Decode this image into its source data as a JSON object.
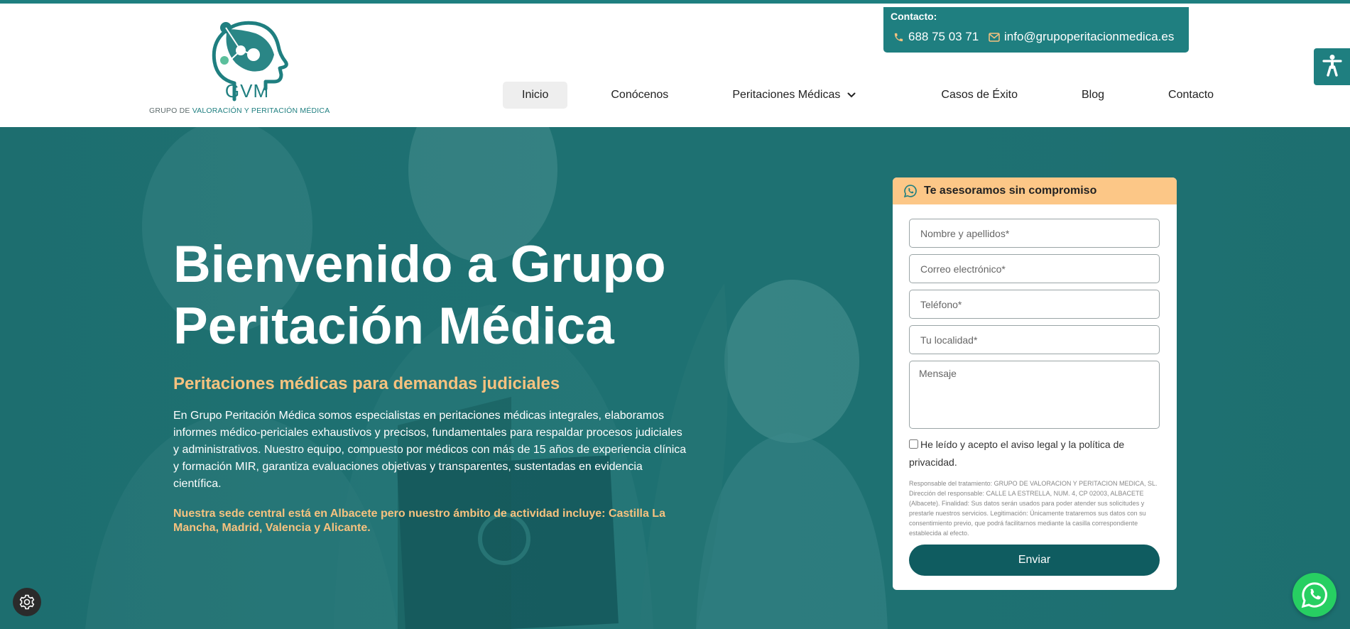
{
  "brand": {
    "caption_prefix": "GRUPO DE ",
    "caption_main": "VALORACIÓN Y PERITACIÓN MÉDICA",
    "logo_text": "GVM",
    "accent": "#1f7f80",
    "highlight": "#f6c27f"
  },
  "contact": {
    "title": "Contacto:",
    "phone": "688 75 03 71",
    "email": "info@grupoperitacionmedica.es",
    "phone_icon": "phone-icon",
    "email_icon": "envelope-icon"
  },
  "nav": {
    "items": [
      {
        "label": "Inicio"
      },
      {
        "label": "Conócenos"
      },
      {
        "label": "Peritaciones Médicas"
      },
      {
        "label": "Casos de Éxito"
      },
      {
        "label": "Blog"
      },
      {
        "label": "Contacto"
      }
    ]
  },
  "hero": {
    "title": "Bienvenido a Grupo Peritación Médica",
    "subtitle": "Peritaciones médicas para demandas judiciales",
    "body": "En Grupo Peritación Médica somos especialistas en peritaciones médicas integrales, elaboramos informes médico-periciales exhaustivos y precisos, fundamentales para respaldar procesos judiciales y administrativos. Nuestro equipo, compuesto por médicos con más de 15 años de experiencia clínica y formación MIR, garantiza evaluaciones objetivas y transparentes, sustentadas en evidencia científica.",
    "note": "Nuestra sede central está en Albacete pero nuestro ámbito de actividad incluye: Castilla La Mancha, Madrid, Valencia y Alicante."
  },
  "form": {
    "heading": "Te asesoramos sin compromiso",
    "name_placeholder": "Nombre y apellidos*",
    "email_placeholder": "Correo electrónico*",
    "phone_placeholder": "Teléfono*",
    "city_placeholder": "Tu localidad*",
    "message_placeholder": "Mensaje",
    "consent": "He leído y acepto el aviso legal y la política de privacidad.",
    "legal": "Responsable del tratamiento: GRUPO DE VALORACION Y PERITACION MEDICA, SL. Dirección del responsable: CALLE LA ESTRELLA, NUM. 4, CP 02003, ALBACETE (Albacete). Finalidad: Sus datos serán usados para poder atender sus solicitudes y prestarle nuestros servicios. Legitimación: Únicamente trataremos sus datos con su consentimiento previo, que podrá facilitarnos mediante la casilla correspondiente establecida al efecto.",
    "submit": "Enviar"
  },
  "icons": {
    "accessibility": "accessibility-icon",
    "whatsapp": "whatsapp-icon",
    "cookie_settings": "gear-icon"
  }
}
